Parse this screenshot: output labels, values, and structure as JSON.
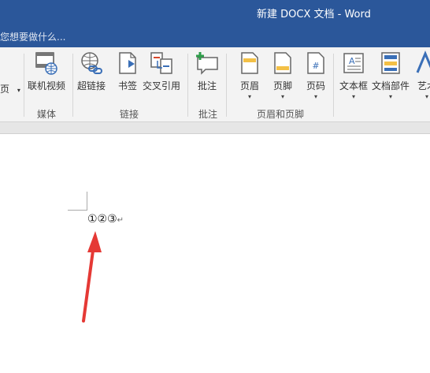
{
  "window": {
    "title": "新建 DOCX 文档 - Word"
  },
  "tell_me": {
    "placeholder": "您想要做什么..."
  },
  "ribbon": {
    "partial_left": {
      "label": "页",
      "caret": "▾"
    },
    "buttons": {
      "online_video": "联机视频",
      "hyperlink": "超链接",
      "bookmark": "书签",
      "cross_reference": "交叉引用",
      "comment": "批注",
      "header": "页眉",
      "footer": "页脚",
      "page_number": "页码",
      "text_box": "文本框",
      "quick_parts": "文档部件",
      "wordart": "艺术"
    },
    "caret": "▾",
    "groups": {
      "media": "媒体",
      "links": "链接",
      "comments": "批注",
      "header_footer": "页眉和页脚"
    }
  },
  "document": {
    "text": "①②③",
    "paragraph_mark": "↵"
  },
  "colors": {
    "titlebar": "#2b579a",
    "annotation_arrow": "#e53935"
  }
}
